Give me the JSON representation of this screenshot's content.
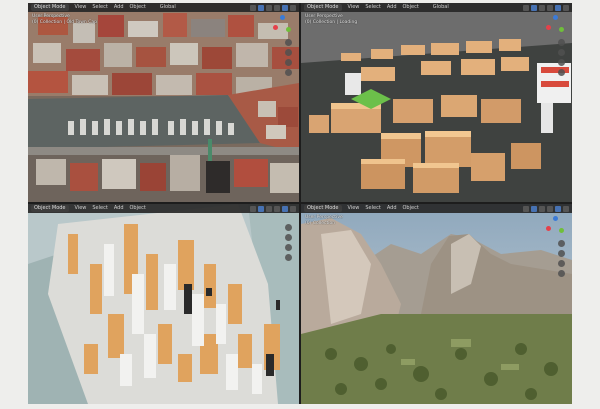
{
  "viewports": [
    {
      "mode": "Object Mode",
      "menus": [
        "View",
        "Select",
        "Add",
        "Object"
      ],
      "orientation": "Global",
      "persp": "User Perspective",
      "collection": "(0) Collection | Old Town Cap"
    },
    {
      "mode": "Object Mode",
      "menus": [
        "View",
        "Select",
        "Add",
        "Object"
      ],
      "orientation": "Global",
      "persp": "User Perspective",
      "collection": "(0) Collection | Loading"
    },
    {
      "mode": "Object Mode",
      "menus": [
        "View",
        "Select",
        "Add",
        "Object"
      ],
      "orientation": "",
      "persp": "",
      "collection": ""
    },
    {
      "mode": "Object Mode",
      "menus": [
        "View",
        "Select",
        "Add",
        "Object"
      ],
      "orientation": "",
      "persp": "User Perspective",
      "collection": "(0) Collection"
    }
  ],
  "icons": {
    "gizmo": "axis-gizmo-icon",
    "zoom": "zoom-icon",
    "pan": "hand-pan-icon",
    "camera": "camera-icon",
    "ortho": "grid-icon"
  },
  "colors": {
    "axis_x": "#e5414a",
    "axis_y": "#6fbf3a",
    "axis_z": "#3b7bd8",
    "header_bg": "#282828",
    "select_blue": "#4772b3"
  }
}
